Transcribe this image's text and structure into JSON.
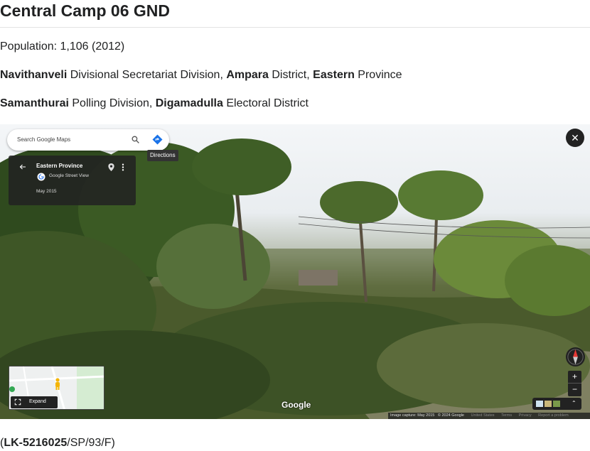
{
  "page": {
    "title": "Central Camp 06 GND",
    "population_label": "Population: 1,106 (2012)",
    "line2": {
      "ds": "Navithanveli",
      "ds_suffix": " Divisional Secretariat Division, ",
      "district": "Ampara",
      "district_suffix": " District, ",
      "province": "Eastern",
      "province_suffix": " Province"
    },
    "line3": {
      "pd": "Samanthurai",
      "pd_suffix": " Polling Division, ",
      "ed": "Digamadulla",
      "ed_suffix": " Electoral District"
    },
    "footer": {
      "open": "(",
      "code": "LK-5216025",
      "rest": "/SP/93/F)"
    }
  },
  "streetview": {
    "search": {
      "placeholder": "Search Google Maps",
      "search_icon": "search-icon",
      "directions_icon": "directions-icon"
    },
    "directions_tooltip": "Directions",
    "info_card": {
      "place": "Eastern Province",
      "source": "Google Street View",
      "date": "May 2015",
      "back_icon": "arrow-left-icon",
      "pin_icon": "map-pin-icon",
      "more_icon": "more-vert-icon"
    },
    "close_icon": "close-icon",
    "close_glyph": "✕",
    "compass_icon": "compass-icon",
    "zoom": {
      "in": "+",
      "out": "−"
    },
    "minimap": {
      "expand_label": "Expand",
      "expand_icon": "fullscreen-icon",
      "pegman_icon": "pegman-icon"
    },
    "brand": "Google",
    "layers_icon": "layers-icon",
    "collapse_glyph": "⌃",
    "attribution": {
      "capture": "Image capture: May 2015",
      "copyright": "© 2024 Google",
      "country": "United States",
      "terms": "Terms",
      "privacy": "Privacy",
      "report": "Report a problem"
    },
    "colors": {
      "panel": "#222222",
      "accent_blue": "#1a73e8",
      "pegman": "#f4b400"
    }
  }
}
